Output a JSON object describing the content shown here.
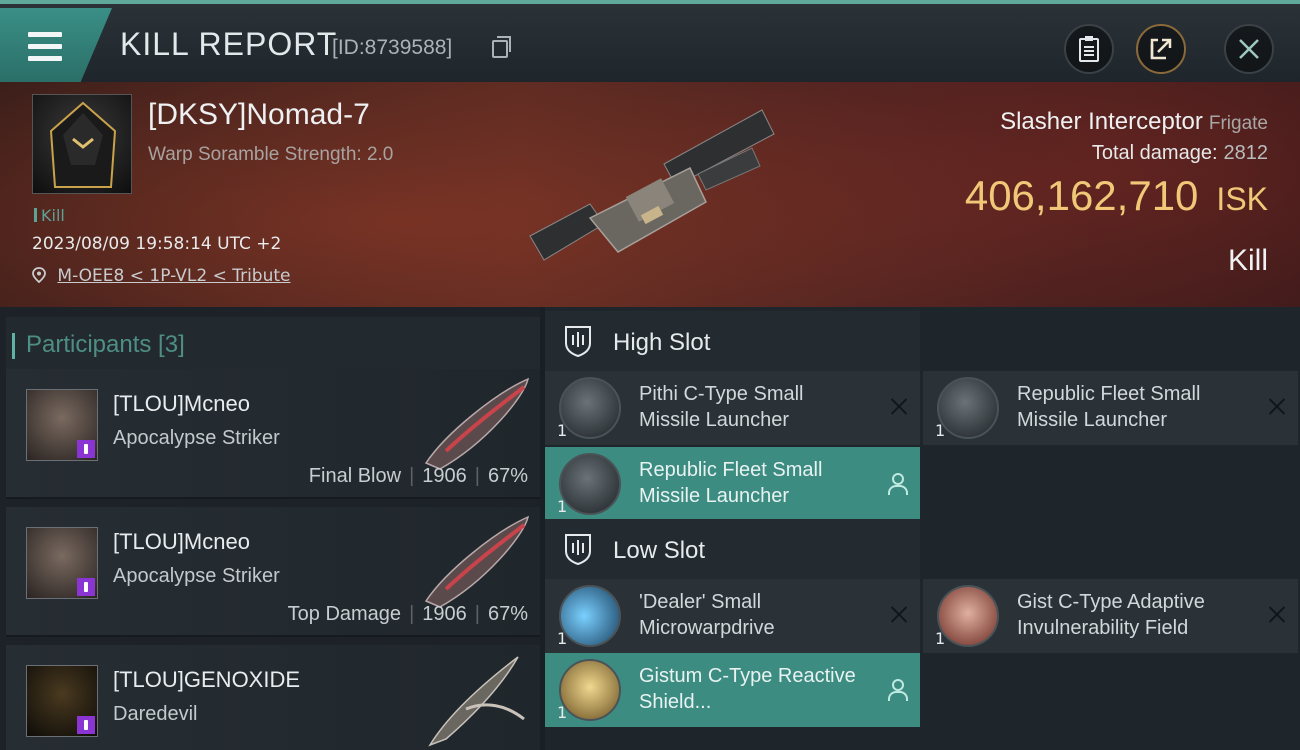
{
  "header": {
    "title": "KILL REPORT",
    "kill_id": "[ID:8739588]"
  },
  "victim": {
    "name": "[DKSY]Nomad-7",
    "warp_scramble": "Warp Soramble Strength: 2.0",
    "kill_tag": "Kill",
    "datetime": "2023/08/09 19:58:14 UTC +2",
    "location": "M-OEE8 < 1P-VL2 < Tribute",
    "ship_name": "Slasher Interceptor",
    "ship_class": "Frigate",
    "total_damage_label": "Total damage:",
    "total_damage": "2812",
    "isk_value": "406,162,710",
    "isk_unit": "ISK",
    "result": "Kill"
  },
  "participants": {
    "title": "Participants [3]",
    "rows": [
      {
        "name": "[TLOU]Mcneo",
        "ship": "Apocalypse Striker",
        "role": "Final Blow",
        "damage": "1906",
        "percent": "67%"
      },
      {
        "name": "[TLOU]Mcneo",
        "ship": "Apocalypse Striker",
        "role": "Top Damage",
        "damage": "1906",
        "percent": "67%"
      },
      {
        "name": "[TLOU]GENOXIDE",
        "ship": "Daredevil"
      }
    ]
  },
  "slots": {
    "high_label": "High Slot",
    "low_label": "Low Slot",
    "high_modules": [
      {
        "name": "Pithi C-Type Small Missile Launcher",
        "qty": "1",
        "status": "destroyed"
      },
      {
        "name": "Republic Fleet Small Missile Launcher",
        "qty": "1",
        "status": "destroyed"
      },
      {
        "name": "Republic Fleet Small Missile Launcher",
        "qty": "1",
        "status": "dropped"
      }
    ],
    "low_modules": [
      {
        "name": "'Dealer' Small Microwarpdrive",
        "qty": "1",
        "status": "destroyed"
      },
      {
        "name": "Gist C-Type Adaptive Invulnerability Field",
        "qty": "1",
        "status": "destroyed"
      },
      {
        "name": "Gistum C-Type Reactive Shield...",
        "qty": "1",
        "status": "dropped"
      }
    ]
  },
  "colors": {
    "accent_teal": "#3d8c82",
    "isk_gold": "#f0c878",
    "badge_purple": "#8a34d4"
  }
}
